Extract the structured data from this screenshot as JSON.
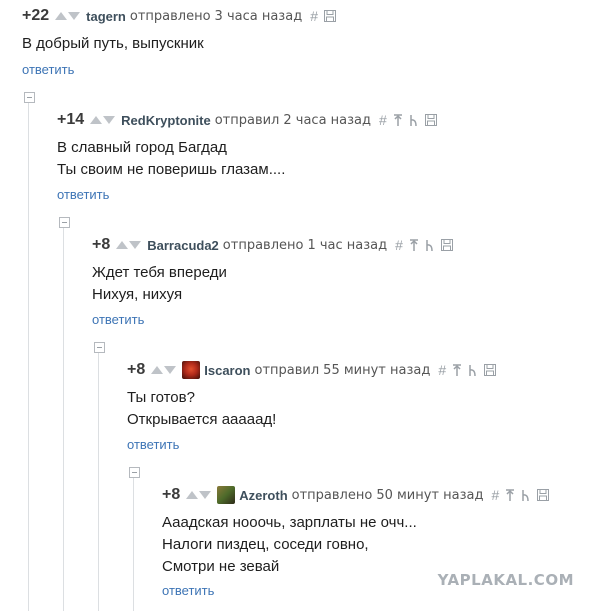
{
  "comments": [
    {
      "rating": "+22",
      "username": "tagern",
      "action": "отправлено",
      "time": "3 часа назад",
      "body": "В добрый путь, выпускник",
      "reply_label": "ответить",
      "icons": [
        "hash-icon",
        "save-icon"
      ]
    },
    {
      "rating": "+14",
      "username": "RedKryptonite",
      "action": "отправил",
      "time": "2 часа назад",
      "body": "В славный город Багдад\nТы своим не поверишь глазам....",
      "reply_label": "ответить",
      "icons": [
        "hash-icon",
        "parent-arrow-icon",
        "branch-icon",
        "save-icon"
      ]
    },
    {
      "rating": "+8",
      "username": "Barracuda2",
      "action": "отправлено",
      "time": "1 час назад",
      "body": "Ждет тебя впереди\nНихуя, нихуя",
      "reply_label": "ответить",
      "icons": [
        "hash-icon",
        "parent-arrow-icon",
        "branch-icon",
        "save-icon"
      ]
    },
    {
      "rating": "+8",
      "username": "Iscaron",
      "action": "отправил",
      "time": "55 минут назад",
      "body": "Ты готов?\nОткрывается ааааад!",
      "reply_label": "ответить",
      "avatar_color": "#b02a1a",
      "icons": [
        "hash-icon",
        "parent-arrow-icon",
        "branch-icon",
        "save-icon"
      ]
    },
    {
      "rating": "+8",
      "username": "Azeroth",
      "action": "отправлено",
      "time": "50 минут назад",
      "body": "Ааадская нооочь, зарплаты не очч...\nНалоги пиздец, соседи говно,\nСмотри не зевай",
      "reply_label": "ответить",
      "avatar_color": "#6a5a2e",
      "icons": [
        "hash-icon",
        "parent-arrow-icon",
        "branch-icon",
        "save-icon"
      ]
    }
  ],
  "watermark": "YAPLAKAL.COM",
  "colors": {
    "link": "#3d74b5",
    "username": "#3e4f5c",
    "vote_arrow": "#bfc3c8"
  }
}
